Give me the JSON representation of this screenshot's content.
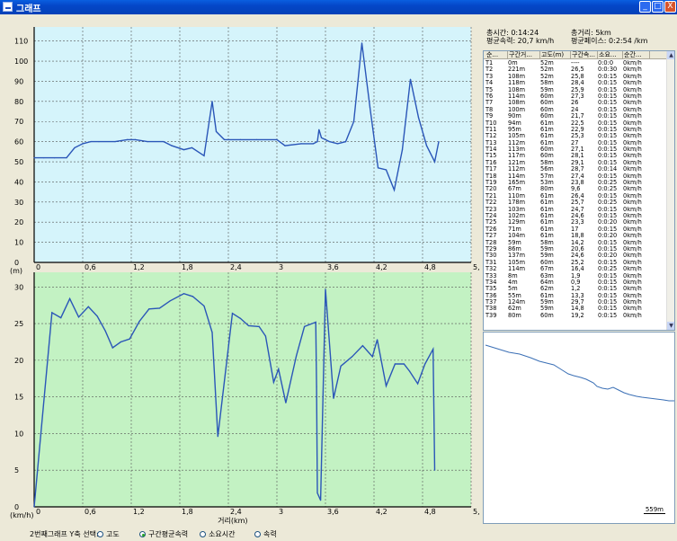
{
  "window": {
    "title": "그래프",
    "buttons": [
      "_",
      "□",
      "X"
    ]
  },
  "summary": {
    "total_time": "총시간:   0:14:24",
    "total_distance": "총거리:  5km",
    "avg_speed": "평균속력: 20,7 km/h",
    "avg_pace": "평균페이스:  0:2:54 /km"
  },
  "table": {
    "headers": [
      "순...",
      "구간거...",
      "고도(m)",
      "구간속...",
      "소요...",
      "순간..."
    ],
    "rows": [
      [
        "T1",
        "0m",
        "52m",
        "----",
        "0:0:0",
        "0km/h"
      ],
      [
        "T2",
        "221m",
        "52m",
        "26,5",
        "0:0:30",
        "0km/h"
      ],
      [
        "T3",
        "108m",
        "52m",
        "25,8",
        "0:0:15",
        "0km/h"
      ],
      [
        "T4",
        "118m",
        "58m",
        "28,4",
        "0:0:15",
        "0km/h"
      ],
      [
        "T5",
        "108m",
        "59m",
        "25,9",
        "0:0:15",
        "0km/h"
      ],
      [
        "T6",
        "114m",
        "60m",
        "27,3",
        "0:0:15",
        "0km/h"
      ],
      [
        "T7",
        "108m",
        "60m",
        "26",
        "0:0:15",
        "0km/h"
      ],
      [
        "T8",
        "100m",
        "60m",
        "24",
        "0:0:15",
        "0km/h"
      ],
      [
        "T9",
        "90m",
        "60m",
        "21,7",
        "0:0:15",
        "0km/h"
      ],
      [
        "T10",
        "94m",
        "61m",
        "22,5",
        "0:0:15",
        "0km/h"
      ],
      [
        "T11",
        "95m",
        "61m",
        "22,9",
        "0:0:15",
        "0km/h"
      ],
      [
        "T12",
        "105m",
        "61m",
        "25,3",
        "0:0:15",
        "0km/h"
      ],
      [
        "T13",
        "112m",
        "61m",
        "27",
        "0:0:15",
        "0km/h"
      ],
      [
        "T14",
        "113m",
        "60m",
        "27,1",
        "0:0:15",
        "0km/h"
      ],
      [
        "T15",
        "117m",
        "60m",
        "28,1",
        "0:0:15",
        "0km/h"
      ],
      [
        "T16",
        "121m",
        "58m",
        "29,1",
        "0:0:15",
        "0km/h"
      ],
      [
        "T17",
        "112m",
        "56m",
        "28,7",
        "0:0:14",
        "0km/h"
      ],
      [
        "T18",
        "114m",
        "57m",
        "27,4",
        "0:0:15",
        "0km/h"
      ],
      [
        "T19",
        "165m",
        "53m",
        "23,8",
        "0:0:25",
        "0km/h"
      ],
      [
        "T20",
        "67m",
        "80m",
        "9,6",
        "0:0:25",
        "0km/h"
      ],
      [
        "T21",
        "110m",
        "61m",
        "26,4",
        "0:0:15",
        "0km/h"
      ],
      [
        "T22",
        "178m",
        "61m",
        "25,7",
        "0:0:25",
        "0km/h"
      ],
      [
        "T23",
        "103m",
        "61m",
        "24,7",
        "0:0:15",
        "0km/h"
      ],
      [
        "T24",
        "102m",
        "61m",
        "24,6",
        "0:0:15",
        "0km/h"
      ],
      [
        "T25",
        "129m",
        "61m",
        "23,3",
        "0:0:20",
        "0km/h"
      ],
      [
        "T26",
        "71m",
        "61m",
        "17",
        "0:0:15",
        "0km/h"
      ],
      [
        "T27",
        "104m",
        "61m",
        "18,8",
        "0:0:20",
        "0km/h"
      ],
      [
        "T28",
        "59m",
        "58m",
        "14,2",
        "0:0:15",
        "0km/h"
      ],
      [
        "T29",
        "86m",
        "59m",
        "20,6",
        "0:0:15",
        "0km/h"
      ],
      [
        "T30",
        "137m",
        "59m",
        "24,6",
        "0:0:20",
        "0km/h"
      ],
      [
        "T31",
        "105m",
        "60m",
        "25,2",
        "0:0:15",
        "0km/h"
      ],
      [
        "T32",
        "114m",
        "67m",
        "16,4",
        "0:0:25",
        "0km/h"
      ],
      [
        "T33",
        "8m",
        "63m",
        "1,9",
        "0:0:15",
        "0km/h"
      ],
      [
        "T34",
        "4m",
        "64m",
        "0,9",
        "0:0:15",
        "0km/h"
      ],
      [
        "T35",
        "5m",
        "62m",
        "1,2",
        "0:0:15",
        "0km/h"
      ],
      [
        "T36",
        "55m",
        "61m",
        "13,3",
        "0:0:15",
        "0km/h"
      ],
      [
        "T37",
        "124m",
        "59m",
        "29,7",
        "0:0:15",
        "0km/h"
      ],
      [
        "T38",
        "62m",
        "59m",
        "14,8",
        "0:0:15",
        "0km/h"
      ],
      [
        "T39",
        "80m",
        "60m",
        "19,2",
        "0:0:15",
        "0km/h"
      ]
    ]
  },
  "map": {
    "scale_label": "559m",
    "route_color": "#3a6fb5"
  },
  "footer": {
    "label": "2번째그래프 Y축 선택:",
    "options": [
      {
        "label": "고도",
        "selected": false
      },
      {
        "label": "구간평균속력",
        "selected": true
      },
      {
        "label": "소요시간",
        "selected": false
      },
      {
        "label": "속력",
        "selected": false
      }
    ]
  },
  "chart_data": [
    {
      "type": "line",
      "title": "",
      "ylabel": "(m)",
      "xlabel": "",
      "xlim": [
        0,
        5.4
      ],
      "ylim": [
        0,
        117
      ],
      "xticks": [
        "0",
        "0,6",
        "1,2",
        "1,8",
        "2,4",
        "3",
        "3,6",
        "4,2",
        "4,8",
        "5,"
      ],
      "yticks": [
        "0",
        "10",
        "20",
        "30",
        "40",
        "50",
        "60",
        "70",
        "80",
        "90",
        "100",
        "110"
      ],
      "grid": true,
      "background": "#d5f4fb",
      "line_color": "#2a56b8",
      "series": [
        {
          "x": [
            0,
            0.12,
            0.25,
            0.4,
            0.5,
            0.6,
            0.7,
            0.8,
            1.0,
            1.15,
            1.25,
            1.4,
            1.6,
            1.7,
            1.85,
            1.95,
            2.1,
            2.2,
            2.25,
            2.35,
            2.55,
            2.75,
            3.0,
            3.1,
            3.3,
            3.45,
            3.5,
            3.52,
            3.55,
            3.65,
            3.75,
            3.85,
            3.95,
            4.05,
            4.15,
            4.25,
            4.35,
            4.45,
            4.55,
            4.65,
            4.75,
            4.85,
            4.95,
            5.0
          ],
          "y": [
            52,
            52,
            52,
            52,
            57,
            59,
            60,
            60,
            60,
            61,
            61,
            60,
            60,
            58,
            56,
            57,
            53,
            80,
            65,
            61,
            61,
            61,
            61,
            58,
            59,
            59,
            60,
            66,
            62,
            60,
            59,
            60,
            70,
            109,
            77,
            47,
            46,
            36,
            56,
            91,
            72,
            58,
            50,
            60
          ]
        }
      ]
    },
    {
      "type": "line",
      "title": "",
      "ylabel": "(km/h)",
      "xlabel": "거리(km)",
      "xlim": [
        0,
        5.4
      ],
      "ylim": [
        0,
        32
      ],
      "xticks": [
        "0",
        "0,6",
        "1,2",
        "1,8",
        "2,4",
        "3",
        "3,6",
        "4,2",
        "4,8",
        "5,"
      ],
      "yticks": [
        "0",
        "5",
        "10",
        "15",
        "20",
        "25",
        "30"
      ],
      "grid": true,
      "background": "#c3f2c3",
      "line_color": "#2a56b8",
      "series": [
        {
          "x": [
            0,
            0.22,
            0.33,
            0.44,
            0.55,
            0.67,
            0.78,
            0.88,
            0.97,
            1.07,
            1.18,
            1.3,
            1.42,
            1.55,
            1.68,
            1.85,
            1.96,
            2.1,
            2.2,
            2.27,
            2.45,
            2.55,
            2.65,
            2.78,
            2.86,
            2.96,
            3.02,
            3.11,
            3.24,
            3.34,
            3.48,
            3.49,
            3.5,
            3.54,
            3.6,
            3.7,
            3.79,
            3.93,
            4.06,
            4.18,
            4.24,
            4.35,
            4.46,
            4.57,
            4.64,
            4.74,
            4.83,
            4.93,
            4.95
          ],
          "y": [
            0,
            26.5,
            25.8,
            28.4,
            25.9,
            27.3,
            26,
            24,
            21.7,
            22.5,
            22.9,
            25.3,
            27,
            27.1,
            28.1,
            29.1,
            28.7,
            27.4,
            23.8,
            9.6,
            26.4,
            25.7,
            24.7,
            24.6,
            23.3,
            17,
            18.8,
            14.2,
            20.6,
            24.6,
            25.2,
            16.4,
            1.9,
            0.9,
            29.7,
            14.8,
            19.2,
            20.5,
            22,
            20.5,
            22.8,
            16.5,
            19.5,
            19.5,
            18.5,
            16.8,
            19.5,
            21.5,
            5
          ]
        }
      ]
    }
  ]
}
